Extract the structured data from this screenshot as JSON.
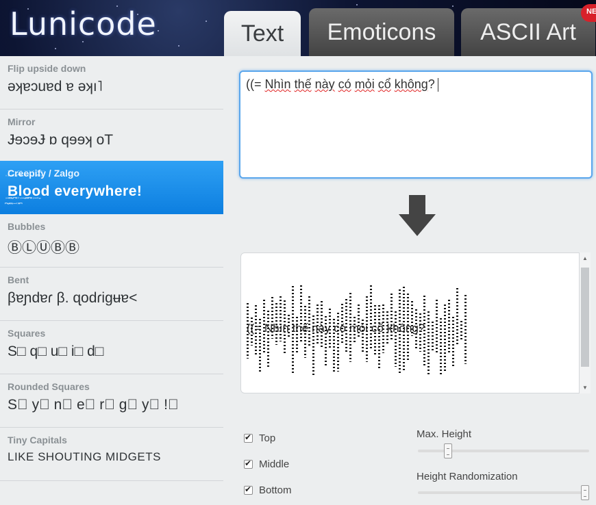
{
  "app": {
    "logo": "Lunicode"
  },
  "tabs": [
    {
      "label": "Text",
      "active": true
    },
    {
      "label": "Emoticons",
      "active": false
    },
    {
      "label": "ASCII Art",
      "active": false
    }
  ],
  "badge": "NE",
  "sidebar": {
    "items": [
      {
        "title": "Flip upside down",
        "sample": "ǝʞɐɔuɐd ɐ ǝʞı˥"
      },
      {
        "title": "Mirror",
        "sample": "ɈɘɔɘɈ ɒ qɘɘʞ oT"
      },
      {
        "title": "Creepify / Zalgo",
        "sample": "Blood everywhere!"
      },
      {
        "title": "Bubbles",
        "sample": "ⒷⓁⓊⒷⒷ"
      },
      {
        "title": "Bent",
        "sample": "βɐɲdɐɾ β. ɋodɾigʉɐ<"
      },
      {
        "title": "Squares",
        "sample": "S□ q□ u□ i□ d□"
      },
      {
        "title": "Rounded Squares",
        "sample": "S⃞ y⃞ n⃞ e⃞ r⃞ g⃞ y⃞ !⃞"
      },
      {
        "title": "Tiny Capitals",
        "sample": "LIKE SHOUTING MIDGETS"
      }
    ]
  },
  "input": {
    "prefix": "((= ",
    "w1": "Nhìn",
    "w2": "thế",
    "w3": "này",
    "w4": "có",
    "w5": "mỏi",
    "w6": "cổ",
    "w7": "không",
    "suffix": "?"
  },
  "output": {
    "text": "((= Nhìn thế này có mỏi cổ không?"
  },
  "options": {
    "top": {
      "label": "Top",
      "checked": true
    },
    "middle": {
      "label": "Middle",
      "checked": true
    },
    "bottom": {
      "label": "Bottom",
      "checked": true
    },
    "max_height": {
      "label": "Max. Height",
      "value": 0.16
    },
    "height_randomization": {
      "label": "Height Randomization",
      "value": 1.0
    }
  },
  "colors": {
    "accent": "#1a8de8",
    "header_bg": "#0d1533"
  }
}
